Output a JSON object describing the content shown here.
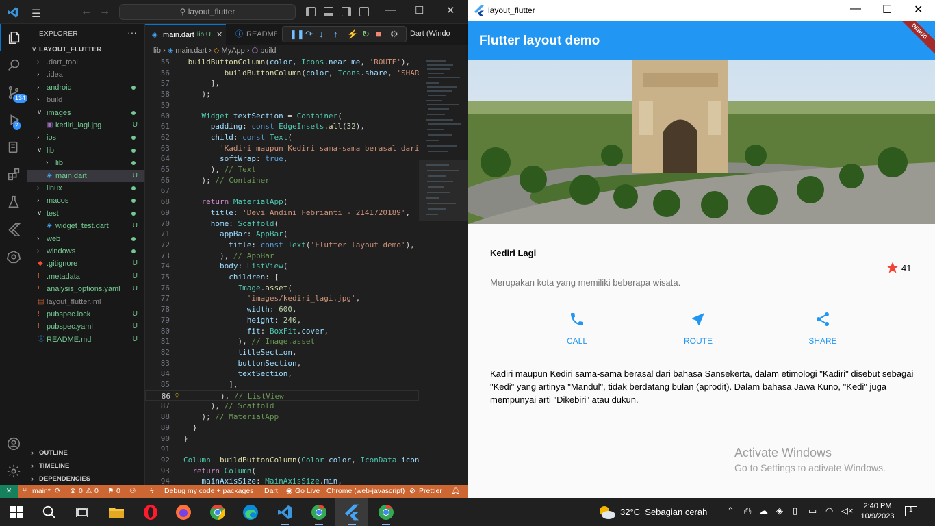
{
  "vscode": {
    "command_center": "layout_flutter",
    "activity_badges": {
      "source_control": "134",
      "run_debug": "2"
    },
    "explorer": {
      "title": "EXPLORER",
      "more": "···",
      "root": "LAYOUT_FLUTTER",
      "items": [
        {
          "label": ".dart_tool",
          "indent": 1,
          "folder": true,
          "color": "#8b8b8b"
        },
        {
          "label": ".idea",
          "indent": 1,
          "folder": true,
          "color": "#8b8b8b"
        },
        {
          "label": "android",
          "indent": 1,
          "folder": true,
          "color": "#73c991",
          "dot": true
        },
        {
          "label": "build",
          "indent": 1,
          "folder": true,
          "color": "#8b8b8b"
        },
        {
          "label": "images",
          "indent": 1,
          "folder": true,
          "open": true,
          "color": "#73c991",
          "dot": true
        },
        {
          "label": "kediri_lagi.jpg",
          "indent": 2,
          "color": "#73c991",
          "status": "U",
          "file": "img"
        },
        {
          "label": "ios",
          "indent": 1,
          "folder": true,
          "color": "#73c991",
          "dot": true
        },
        {
          "label": "lib",
          "indent": 1,
          "folder": true,
          "open": true,
          "color": "#73c991",
          "dot": true
        },
        {
          "label": "lib",
          "indent": 2,
          "folder": true,
          "color": "#73c991",
          "dot": true
        },
        {
          "label": "main.dart",
          "indent": 2,
          "color": "#73c991",
          "status": "U",
          "file": "dart",
          "selected": true
        },
        {
          "label": "linux",
          "indent": 1,
          "folder": true,
          "color": "#73c991",
          "dot": true
        },
        {
          "label": "macos",
          "indent": 1,
          "folder": true,
          "color": "#73c991",
          "dot": true
        },
        {
          "label": "test",
          "indent": 1,
          "folder": true,
          "open": true,
          "color": "#73c991",
          "dot": true
        },
        {
          "label": "widget_test.dart",
          "indent": 2,
          "color": "#73c991",
          "status": "U",
          "file": "dart"
        },
        {
          "label": "web",
          "indent": 1,
          "folder": true,
          "color": "#73c991",
          "dot": true
        },
        {
          "label": "windows",
          "indent": 1,
          "folder": true,
          "color": "#73c991",
          "dot": true
        },
        {
          "label": ".gitignore",
          "indent": 1,
          "color": "#73c991",
          "status": "U",
          "file": "git"
        },
        {
          "label": ".metadata",
          "indent": 1,
          "color": "#73c991",
          "status": "U",
          "file": "bang"
        },
        {
          "label": "analysis_options.yaml",
          "indent": 1,
          "color": "#73c991",
          "status": "U",
          "file": "bang"
        },
        {
          "label": "layout_flutter.iml",
          "indent": 1,
          "color": "#8b8b8b",
          "file": "iml"
        },
        {
          "label": "pubspec.lock",
          "indent": 1,
          "color": "#73c991",
          "status": "U",
          "file": "bang"
        },
        {
          "label": "pubspec.yaml",
          "indent": 1,
          "color": "#73c991",
          "status": "U",
          "file": "bang"
        },
        {
          "label": "README.md",
          "indent": 1,
          "color": "#73c991",
          "status": "U",
          "file": "info"
        }
      ],
      "sections": [
        "OUTLINE",
        "TIMELINE",
        "DEPENDENCIES"
      ]
    },
    "tabs": [
      {
        "label": "main.dart",
        "hint": "lib U",
        "active": true
      },
      {
        "label": "README",
        "hint": ""
      }
    ],
    "debug_target": "Dart (Windo",
    "breadcrumb": {
      "p1": "lib",
      "p2": "main.dart",
      "p3": "MyApp",
      "p4": "build"
    },
    "code_lines": [
      {
        "n": "55",
        "h": "<span class='fn'>_buildButtonColumn</span>(<span class='va'>color</span>, <span class='ty'>Icons</span>.<span class='va'>near_me</span>, <span class='st'>'ROUTE'</span>),"
      },
      {
        "n": "56",
        "h": "        <span class='fn'>_buildButtonColumn</span>(<span class='va'>color</span>, <span class='ty'>Icons</span>.<span class='va'>share</span>, <span class='st'>'SHARE'</span>),"
      },
      {
        "n": "57",
        "h": "      ],"
      },
      {
        "n": "58",
        "h": "    );"
      },
      {
        "n": "59",
        "h": ""
      },
      {
        "n": "60",
        "h": "    <span class='ty'>Widget</span> <span class='va'>textSection</span> = <span class='ty'>Container</span>("
      },
      {
        "n": "61",
        "h": "      <span class='va'>padding</span>: <span class='kw'>const</span> <span class='ty'>EdgeInsets</span>.<span class='fn'>all</span>(<span class='nu'>32</span>),"
      },
      {
        "n": "62",
        "h": "      <span class='va'>child</span>: <span class='kw'>const</span> <span class='ty'>Text</span>("
      },
      {
        "n": "63",
        "h": "        <span class='st'>'Kadiri maupun Kediri sama-sama berasal dari bahasa</span>"
      },
      {
        "n": "64",
        "h": "        <span class='va'>softWrap</span>: <span class='kw'>true</span>,"
      },
      {
        "n": "65",
        "h": "      ), <span class='cm'>// Text</span>"
      },
      {
        "n": "66",
        "h": "    ); <span class='cm'>// Container</span>"
      },
      {
        "n": "67",
        "h": ""
      },
      {
        "n": "68",
        "h": "    <span class='kw2'>return</span> <span class='ty'>MaterialApp</span>("
      },
      {
        "n": "69",
        "h": "      <span class='va'>title</span>: <span class='st'>'Devi Andini Febrianti - 2141720189'</span>,"
      },
      {
        "n": "70",
        "h": "      <span class='va'>home</span>: <span class='ty'>Scaffold</span>("
      },
      {
        "n": "71",
        "h": "        <span class='va'>appBar</span>: <span class='ty'>AppBar</span>("
      },
      {
        "n": "72",
        "h": "          <span class='va'>title</span>: <span class='kw'>const</span> <span class='ty'>Text</span>(<span class='st'>'Flutter layout demo'</span>),"
      },
      {
        "n": "73",
        "h": "        ), <span class='cm'>// AppBar</span>"
      },
      {
        "n": "74",
        "h": "        <span class='va'>body</span>: <span class='ty'>ListView</span>("
      },
      {
        "n": "75",
        "h": "          <span class='va'>children</span>: ["
      },
      {
        "n": "76",
        "h": "            <span class='ty'>Image</span>.<span class='fn'>asset</span>("
      },
      {
        "n": "77",
        "h": "              <span class='st'>'images/kediri_lagi.jpg'</span>,"
      },
      {
        "n": "78",
        "h": "              <span class='va'>width</span>: <span class='nu'>600</span>,"
      },
      {
        "n": "79",
        "h": "              <span class='va'>height</span>: <span class='nu'>240</span>,"
      },
      {
        "n": "80",
        "h": "              <span class='va'>fit</span>: <span class='ty'>BoxFit</span>.<span class='va'>cover</span>,"
      },
      {
        "n": "81",
        "h": "            ), <span class='cm'>// Image.asset</span>"
      },
      {
        "n": "82",
        "h": "            <span class='va'>titleSection</span>,"
      },
      {
        "n": "83",
        "h": "            <span class='va'>buttonSection</span>,"
      },
      {
        "n": "84",
        "h": "            <span class='va'>textSection</span>,"
      },
      {
        "n": "85",
        "h": "          ],"
      },
      {
        "n": "86",
        "h": "        ), <span class='cm'>// ListView</span>",
        "current": true
      },
      {
        "n": "87",
        "h": "      ), <span class='cm'>// Scaffold</span>"
      },
      {
        "n": "88",
        "h": "    ); <span class='cm'>// MaterialApp</span>"
      },
      {
        "n": "89",
        "h": "  }"
      },
      {
        "n": "90",
        "h": "}"
      },
      {
        "n": "91",
        "h": ""
      },
      {
        "n": "92",
        "h": "<span class='ty'>Column</span> <span class='fn'>_buildButtonColumn</span>(<span class='ty'>Color</span> <span class='va'>color</span>, <span class='ty'>IconData</span> <span class='va'>icon</span>"
      },
      {
        "n": "93",
        "h": "  <span class='kw2'>return</span> <span class='ty'>Column</span>("
      },
      {
        "n": "94",
        "h": "    <span class='va'>mainAxisSize</span>: <span class='ty'>MainAxisSize</span>.<span class='va'>min</span>,"
      }
    ],
    "statusbar": {
      "branch": "main*",
      "errors": "0",
      "warnings": "0",
      "ports": "0",
      "debug": "Debug my code + packages",
      "lang": "Dart",
      "golive": "Go Live",
      "device": "Chrome (web-javascript)",
      "prettier": "Prettier"
    }
  },
  "flutter_window": {
    "title": "layout_flutter",
    "appbar_title": "Flutter layout demo",
    "debug_banner": "DEBUG",
    "title_section": {
      "name": "Kediri Lagi",
      "description": "Merupakan kota yang memiliki beberapa wisata.",
      "star_count": "41"
    },
    "buttons": [
      {
        "label": "CALL",
        "icon": "phone-icon"
      },
      {
        "label": "ROUTE",
        "icon": "near-me-icon"
      },
      {
        "label": "SHARE",
        "icon": "share-icon"
      }
    ],
    "text_section": "Kadiri maupun Kediri sama-sama berasal dari bahasa Sansekerta, dalam etimologi \"Kadiri\" disebut sebagai \"Kedi\" yang artinya \"Mandul\", tidak berdatang bulan (aprodit). Dalam bahasa Jawa Kuno, \"Kedi\" juga mempunyai arti \"Dikebiri\" atau dukun.",
    "activate_title": "Activate Windows",
    "activate_sub": "Go to Settings to activate Windows.",
    "colors": {
      "primary": "#2196f3",
      "star": "#f44336"
    }
  },
  "taskbar": {
    "weather_temp": "32°C",
    "weather_desc": "Sebagian cerah",
    "time": "2:40 PM",
    "date": "10/9/2023",
    "notifications": "1"
  }
}
